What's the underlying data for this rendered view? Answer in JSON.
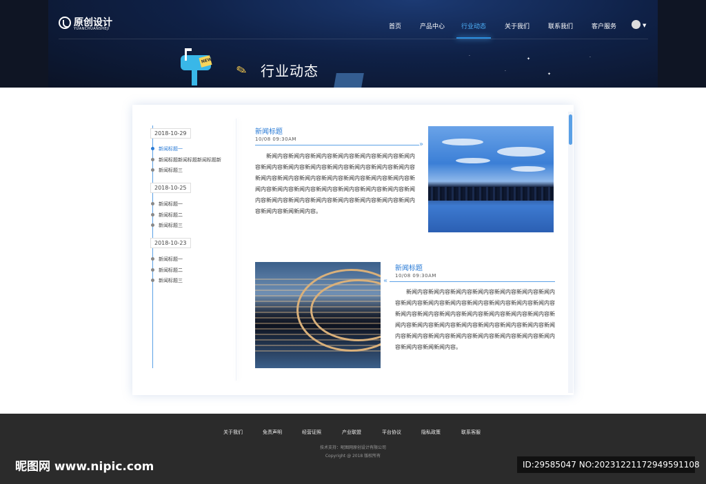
{
  "header": {
    "logo_text": "原创设计",
    "logo_sub": "YUANCHUANSHEJI",
    "nav": [
      "首页",
      "产品中心",
      "行业动态",
      "关于我们",
      "联系我们",
      "客户服务"
    ],
    "active_nav": "行业动态",
    "banner_title": "行业动态",
    "mailbox_badge": "NEW"
  },
  "sidebar": {
    "groups": [
      {
        "date": "2018-10-29",
        "items": [
          "新闻标题一",
          "新闻标题新闻标题新闻标题新",
          "新闻标题三"
        ]
      },
      {
        "date": "2018-10-25",
        "items": [
          "新闻标题一",
          "新闻标题二",
          "新闻标题三"
        ]
      },
      {
        "date": "2018-10-23",
        "items": [
          "新闻标题一",
          "新闻标题二",
          "新闻标题三"
        ]
      }
    ],
    "active_item": "新闻标题一"
  },
  "news": [
    {
      "title": "新闻标题",
      "meta": "10/08  09:30AM",
      "body": "新闻内容新闻内容新闻内容新闻内容新闻内容新闻内容新闻内容新闻内容新闻内容新闻内容新闻内容新闻内容新闻内容新闻内容新闻内容新闻内容新闻内容新闻内容新闻内容新闻内容新闻内容新闻内容新闻内容新闻内容新闻内容新闻内容新闻内容新闻内容新闻内容新闻内容新闻内容新闻内容新闻内容新闻内容新闻内容新闻内容新闻内容新闻新闻内容。"
    },
    {
      "title": "新闻标题",
      "meta": "10/08  09:30AM",
      "body": "新闻内容新闻内容新闻内容新闻内容新闻内容新闻内容新闻内容新闻内容新闻内容新闻内容新闻内容新闻内容新闻内容新闻内容新闻内容新闻内容新闻内容新闻内容新闻内容新闻内容新闻内容新闻内容新闻内容新闻内容新闻内容新闻内容新闻内容新闻内容新闻内容新闻内容新闻内容新闻内容新闻内容新闻内容新闻内容新闻内容新闻内容新闻新闻内容。"
    }
  ],
  "footer": {
    "links": [
      "关于我们",
      "免责声明",
      "经营证照",
      "产业联盟",
      "平台协议",
      "隐私政策",
      "联系客服"
    ],
    "tech": "技术支持：昵图网原创设计有限公司",
    "copyright": "Copyright @ 2018   版权所有"
  },
  "watermark": {
    "left": "昵图网 www.nipic.com",
    "right": "ID:29585047 NO:20231221172949591108"
  },
  "colors": {
    "accent": "#2a7bd6",
    "header_bg": "#0b1326",
    "footer_bg": "#2b2b2b"
  }
}
